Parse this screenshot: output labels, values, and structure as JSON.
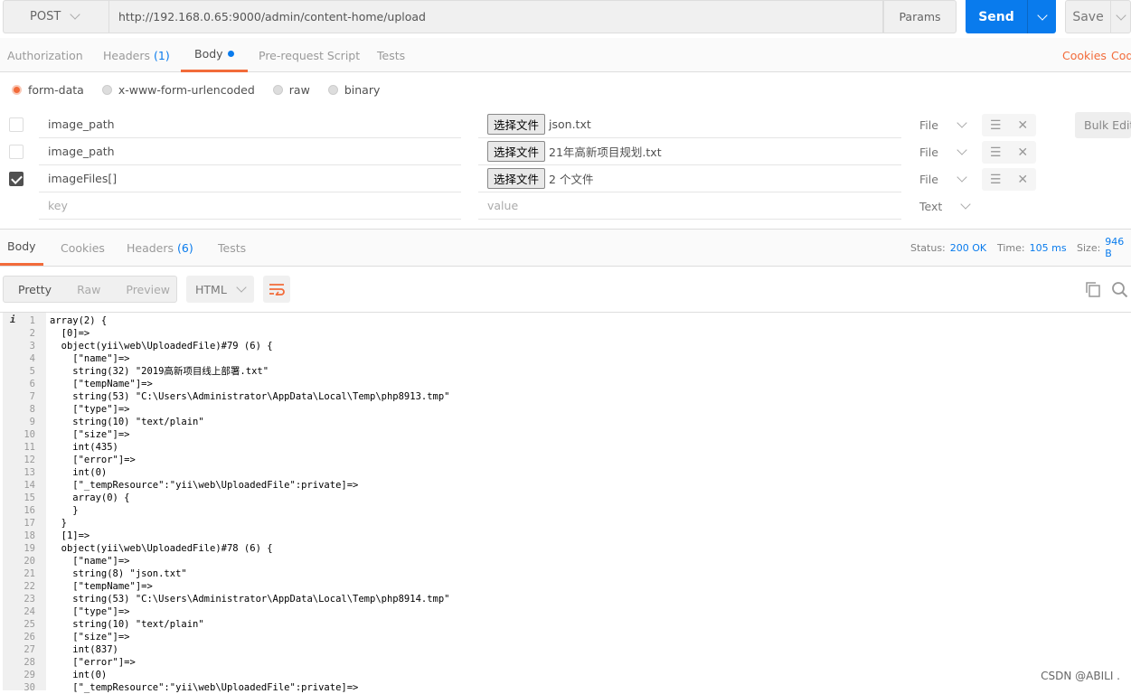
{
  "request": {
    "method": "POST",
    "url": "http://192.168.0.65:9000/admin/content-home/upload",
    "params_label": "Params",
    "send_label": "Send",
    "save_label": "Save"
  },
  "request_tabs": [
    {
      "label": "Authorization"
    },
    {
      "label": "Headers",
      "count": "(1)"
    },
    {
      "label": "Body",
      "active": true
    },
    {
      "label": "Pre-request Script"
    },
    {
      "label": "Tests"
    }
  ],
  "request_links": {
    "cookies": "Cookies",
    "code": "Code"
  },
  "body_modes": [
    "form-data",
    "x-www-form-urlencoded",
    "raw",
    "binary"
  ],
  "selected_body_mode": "form-data",
  "form_rows": [
    {
      "checked": false,
      "key": "image_path",
      "file_button": "选择文件",
      "value": "json.txt",
      "type": "File"
    },
    {
      "checked": false,
      "key": "image_path",
      "file_button": "选择文件",
      "value": "21年高新项目规划.txt",
      "type": "File"
    },
    {
      "checked": true,
      "key": "imageFiles[]",
      "file_button": "选择文件",
      "value": "2 个文件",
      "type": "File"
    }
  ],
  "new_row": {
    "key_placeholder": "key",
    "value_placeholder": "value",
    "type": "Text"
  },
  "bulk_edit_label": "Bulk Edit",
  "response_tabs": [
    {
      "label": "Body",
      "active": true
    },
    {
      "label": "Cookies"
    },
    {
      "label": "Headers",
      "count": "(6)"
    },
    {
      "label": "Tests"
    }
  ],
  "response_status": {
    "status_label": "Status:",
    "status": "200 OK",
    "time_label": "Time:",
    "time": "105 ms",
    "size_label": "Size:",
    "size": "946 B"
  },
  "view_modes": [
    "Pretty",
    "Raw",
    "Preview"
  ],
  "format": "HTML",
  "code_lines": [
    "array(2) {",
    "  [0]=>",
    "  object(yii\\web\\UploadedFile)#79 (6) {",
    "    [\"name\"]=>",
    "    string(32) \"2019高新项目线上部署.txt\"",
    "    [\"tempName\"]=>",
    "    string(53) \"C:\\Users\\Administrator\\AppData\\Local\\Temp\\php8913.tmp\"",
    "    [\"type\"]=>",
    "    string(10) \"text/plain\"",
    "    [\"size\"]=>",
    "    int(435)",
    "    [\"error\"]=>",
    "    int(0)",
    "    [\"_tempResource\":\"yii\\web\\UploadedFile\":private]=>",
    "    array(0) {",
    "    }",
    "  }",
    "  [1]=>",
    "  object(yii\\web\\UploadedFile)#78 (6) {",
    "    [\"name\"]=>",
    "    string(8) \"json.txt\"",
    "    [\"tempName\"]=>",
    "    string(53) \"C:\\Users\\Administrator\\AppData\\Local\\Temp\\php8914.tmp\"",
    "    [\"type\"]=>",
    "    string(10) \"text/plain\"",
    "    [\"size\"]=>",
    "    int(837)",
    "    [\"error\"]=>",
    "    int(0)",
    "    [\"_tempResource\":\"yii\\web\\UploadedFile\":private]=>"
  ],
  "watermark": "CSDN @ABILI .",
  "colors": {
    "accent": "#f26b3a",
    "send": "#097bed",
    "link_blue": "#097bed"
  }
}
